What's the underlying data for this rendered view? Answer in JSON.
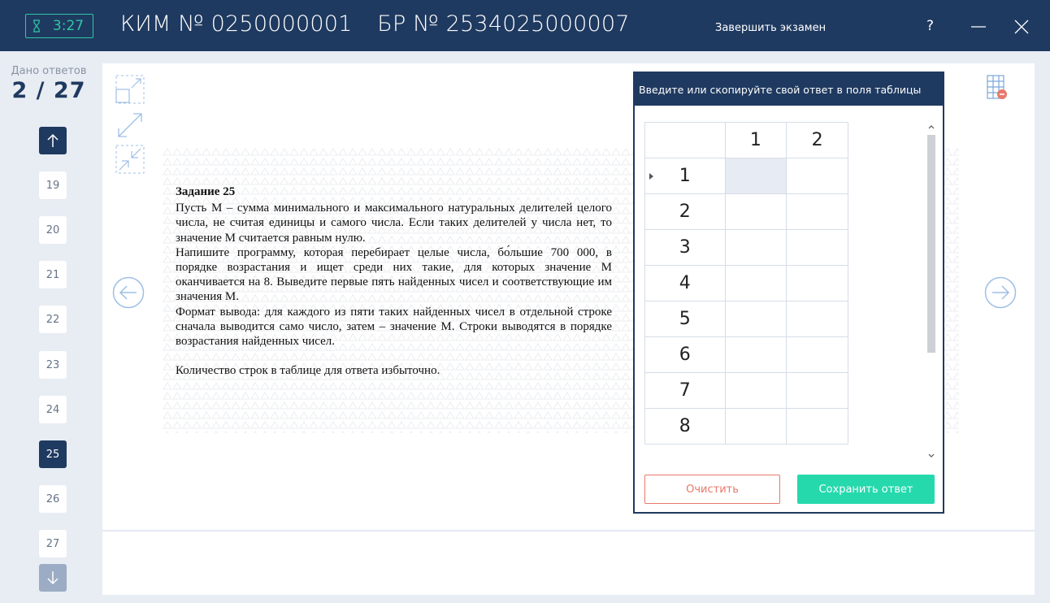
{
  "header": {
    "timer": "3:27",
    "kim_label": "КИМ № 0250000001",
    "br_label": "БР № 2534025000007",
    "finish_exam": "Завершить экзамен",
    "help": "?"
  },
  "sidebar": {
    "answered_label": "Дано ответов",
    "answered_count": "2 / 27",
    "tasks": [
      "19",
      "20",
      "21",
      "22",
      "23",
      "24",
      "25",
      "26",
      "27"
    ],
    "active_task": "25"
  },
  "task": {
    "title": "Задание 25",
    "paragraph1": "Пусть M – сумма минимального и максимального натуральных делителей целого числа, не считая единицы и самого числа. Если таких делителей у числа нет, то значение M считается равным нулю.",
    "paragraph2": "Напишите программу, которая перебирает целые числа, бо́льшие 700 000, в порядке возрастания и ищет среди них такие, для которых значение M оканчивается на 8. Выведите первые пять найденных чисел и соответствующие им значения M.",
    "paragraph3": "Формат вывода: для каждого из пяти таких найденных чисел в отдельной строке сначала выводится само число, затем – значение M. Строки выводятся в порядке возрастания найденных чисел.",
    "note": "Количество строк в таблице для ответа избыточно."
  },
  "answer_panel": {
    "title": "Введите или скопируйте свой ответ в поля таблицы",
    "columns": [
      "1",
      "2"
    ],
    "rows": [
      "1",
      "2",
      "3",
      "4",
      "5",
      "6",
      "7",
      "8"
    ],
    "clear_label": "Очистить",
    "save_label": "Сохранить ответ"
  },
  "colors": {
    "header_bg": "#1f3a60",
    "accent_green": "#25d9ad",
    "timer_green": "#2fc7a6",
    "clear_red": "#e8786a",
    "background": "#e8ecf3"
  },
  "icons": [
    "hourglass-icon",
    "minimize-icon",
    "close-icon",
    "arrow-up-icon",
    "arrow-down-icon",
    "zoom-fit-icon",
    "zoom-in-icon",
    "zoom-out-icon",
    "arrow-left-icon",
    "arrow-right-icon",
    "table-grid-icon"
  ]
}
